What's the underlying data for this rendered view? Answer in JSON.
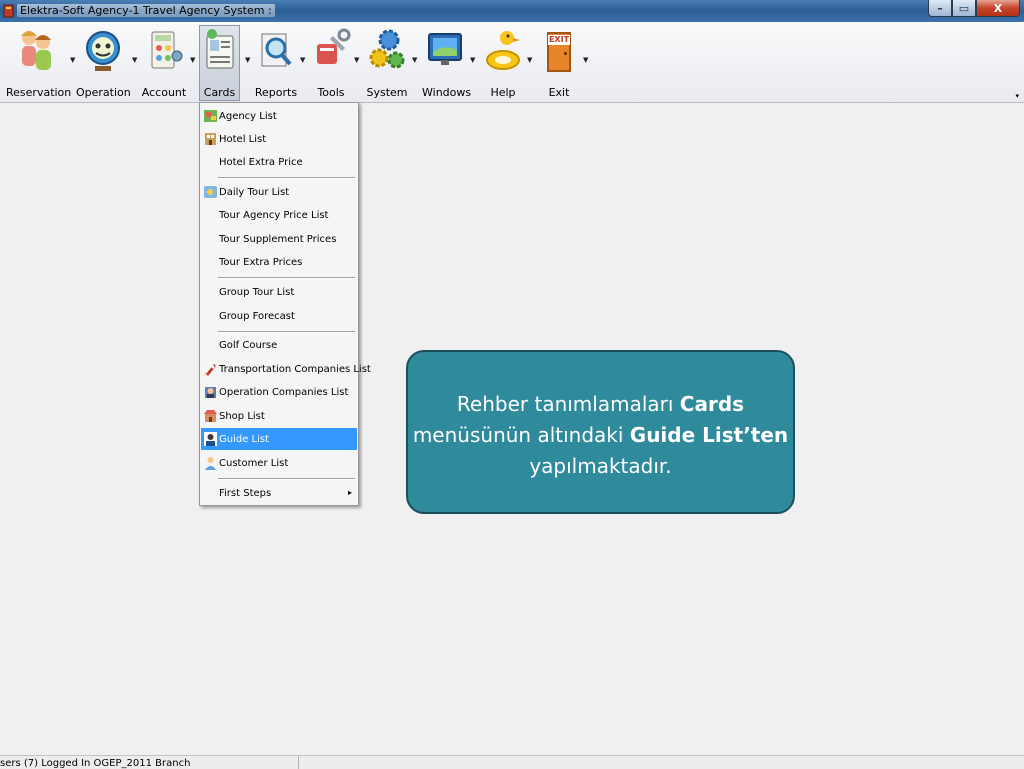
{
  "window": {
    "title": "Elektra-Soft Agency-1 Travel Agency System :",
    "minimize": "–",
    "maximize": "▭",
    "close": "X"
  },
  "toolbar": {
    "items": [
      {
        "label": "Reservation",
        "icon": "people-icon"
      },
      {
        "label": "Operation",
        "icon": "globe-clock-icon"
      },
      {
        "label": "Account",
        "icon": "calculator-icon"
      },
      {
        "label": "Cards",
        "icon": "address-card-icon"
      },
      {
        "label": "Reports",
        "icon": "magnifier-report-icon"
      },
      {
        "label": "Tools",
        "icon": "tools-icon"
      },
      {
        "label": "System",
        "icon": "gears-icon"
      },
      {
        "label": "Windows",
        "icon": "monitor-icon"
      },
      {
        "label": "Help",
        "icon": "lifebuoy-duck-icon"
      },
      {
        "label": "Exit",
        "icon": "exit-door-icon"
      }
    ],
    "exit_sign": "EXIT"
  },
  "menu": {
    "items": [
      {
        "label": "Agency List",
        "icon": "map-icon"
      },
      {
        "label": "Hotel List",
        "icon": "hotel-icon"
      },
      {
        "label": "Hotel Extra Price"
      },
      {
        "label": "Daily Tour List",
        "icon": "tour-icon"
      },
      {
        "label": "Tour Agency Price List"
      },
      {
        "label": "Tour Supplement Prices"
      },
      {
        "label": "Tour Extra Prices"
      },
      {
        "label": "Group Tour List"
      },
      {
        "label": "Group Forecast"
      },
      {
        "label": "Golf Course"
      },
      {
        "label": "Transportation Companies List",
        "icon": "rocket-icon"
      },
      {
        "label": "Operation Companies List",
        "icon": "building-icon"
      },
      {
        "label": "Shop List",
        "icon": "shop-icon"
      },
      {
        "label": "Guide List",
        "icon": "guide-icon",
        "selected": true
      },
      {
        "label": "Customer List",
        "icon": "customer-icon"
      },
      {
        "label": "First Steps",
        "submenu": true
      }
    ],
    "submenu_arrow": "▸"
  },
  "callout": {
    "part1": "Rehber tanımlamaları ",
    "bold1": "Cards",
    "part2": " menüsünün altındaki ",
    "bold2": "Guide List’ten",
    "part3": " yapılmaktadır."
  },
  "status": {
    "text": "sers (7) Logged In OGEP_2011 Branch"
  },
  "colors": {
    "callout_fill": "#2f8a9c",
    "selection": "#3399ff"
  }
}
